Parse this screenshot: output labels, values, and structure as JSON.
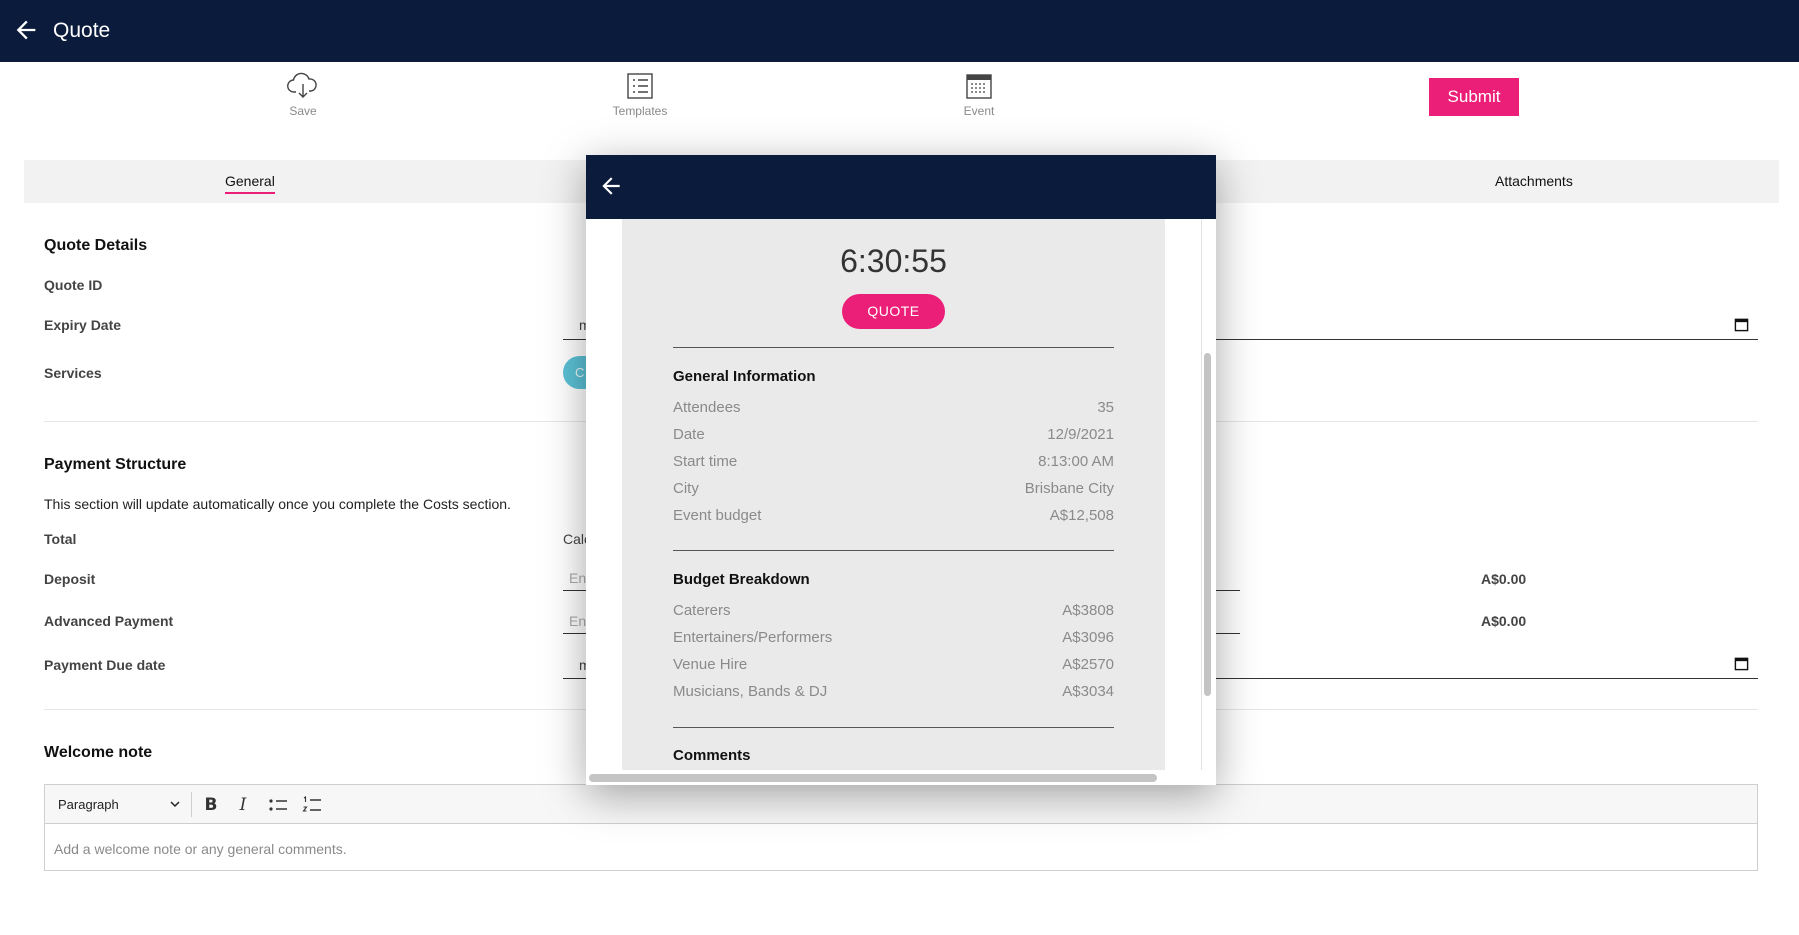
{
  "appbar": {
    "title": "Quote"
  },
  "toolbar": {
    "save_label": "Save",
    "templates_label": "Templates",
    "event_label": "Event",
    "submit_label": "Submit"
  },
  "tabs": {
    "general": "General",
    "attachments": "Attachments"
  },
  "quote_details": {
    "heading": "Quote Details",
    "quote_id_label": "Quote ID",
    "expiry_label": "Expiry Date",
    "expiry_value_visible": "m",
    "services_label": "Services",
    "service_chip_visible": "C"
  },
  "payment": {
    "heading": "Payment Structure",
    "note": "This section will update automatically once you complete the Costs section.",
    "total_label": "Total",
    "total_value_visible": "Calc",
    "deposit_label": "Deposit",
    "deposit_placeholder_visible": "Ent",
    "deposit_amount": "A$0.00",
    "advanced_label": "Advanced Payment",
    "advanced_placeholder_visible": "Ent",
    "advanced_amount": "A$0.00",
    "due_label": "Payment Due date",
    "due_value_visible": "m"
  },
  "welcome": {
    "heading": "Welcome note",
    "format_select": "Paragraph",
    "bold_icon": "B",
    "italic_icon": "I",
    "placeholder": "Add a welcome note or any general comments."
  },
  "modal": {
    "timer": "6:30:55",
    "quote_button": "QUOTE",
    "general_title": "General Information",
    "general_rows": [
      {
        "label": "Attendees",
        "value": "35"
      },
      {
        "label": "Date",
        "value": "12/9/2021"
      },
      {
        "label": "Start time",
        "value": "8:13:00 AM"
      },
      {
        "label": "City",
        "value": "Brisbane City"
      },
      {
        "label": "Event budget",
        "value": "A$12,508"
      }
    ],
    "budget_title": "Budget Breakdown",
    "budget_rows": [
      {
        "label": "Caterers",
        "value": "A$3808"
      },
      {
        "label": "Entertainers/Performers",
        "value": "A$3096"
      },
      {
        "label": "Venue Hire",
        "value": "A$2570"
      },
      {
        "label": "Musicians, Bands & DJ",
        "value": "A$3034"
      }
    ],
    "comments_title": "Comments"
  },
  "colors": {
    "navy": "#0a1b3b",
    "accent": "#ec1f78",
    "chip": "#5bc2d6"
  },
  "icons": [
    "back-arrow-icon",
    "cloud-download-icon",
    "list-icon",
    "calendar-icon",
    "chevron-down-icon",
    "bullet-list-icon",
    "numbered-list-icon"
  ]
}
